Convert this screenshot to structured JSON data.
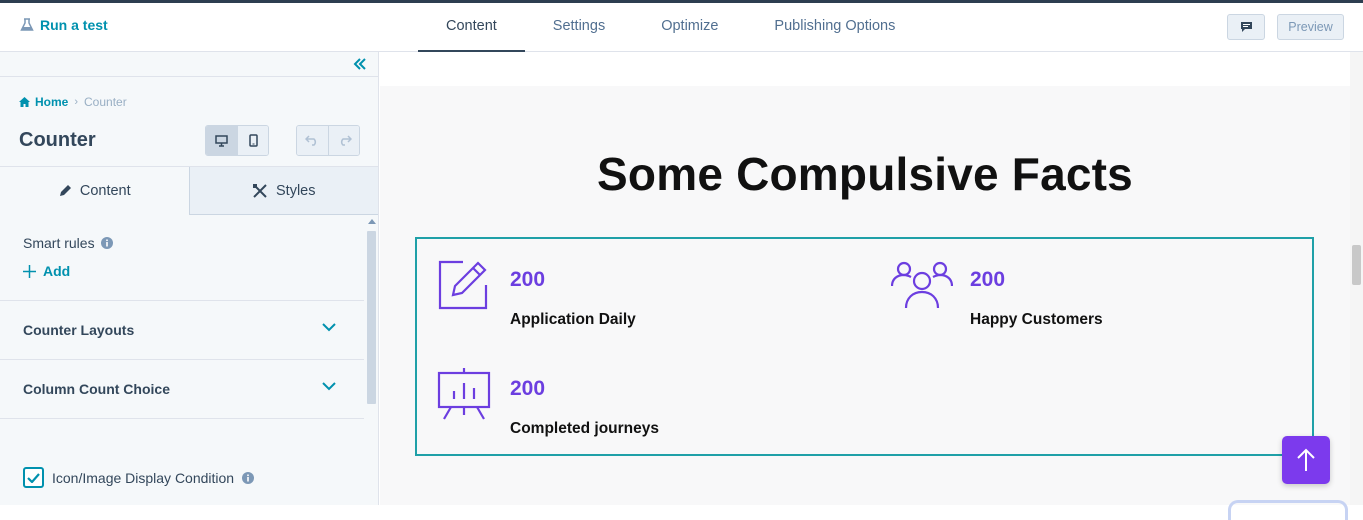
{
  "topbar": {
    "run_test": "Run a test",
    "tabs": [
      "Content",
      "Settings",
      "Optimize",
      "Publishing Options"
    ],
    "active_tab": "Content",
    "preview": "Preview"
  },
  "sidebar": {
    "breadcrumb": {
      "home": "Home",
      "current": "Counter"
    },
    "title": "Counter",
    "panel_tabs": {
      "content": "Content",
      "styles": "Styles"
    },
    "smart_rules": "Smart rules",
    "add": "Add",
    "sections": [
      "Counter Layouts",
      "Column Count Choice"
    ],
    "checkbox_label": "Icon/Image Display Condition",
    "checkbox_checked": true
  },
  "canvas": {
    "heading": "Some Compulsive Facts",
    "counters": [
      {
        "icon": "edit-icon",
        "value": "200",
        "label": "Application Daily"
      },
      {
        "icon": "customers-icon",
        "value": "200",
        "label": "Happy Customers"
      },
      {
        "icon": "presentation-chart-icon",
        "value": "200",
        "label": "Completed journeys"
      }
    ]
  },
  "colors": {
    "accent_teal": "#0091ae",
    "counter_purple": "#6c3ee0",
    "up_button": "#7c3aed",
    "selection_border": "#1fa0a8"
  }
}
